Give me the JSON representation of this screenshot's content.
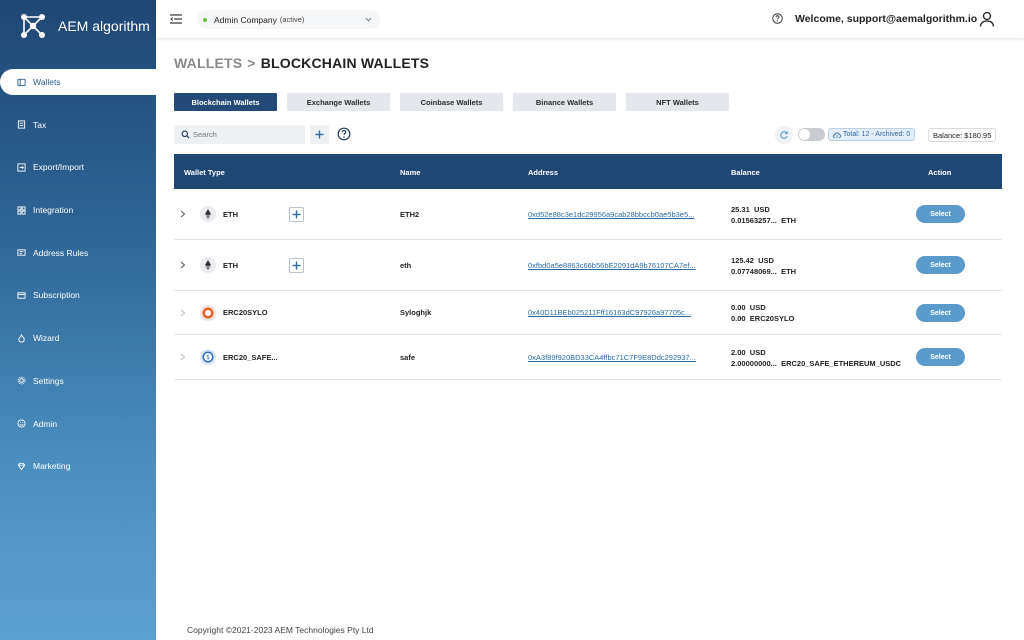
{
  "app": {
    "name": "AEM algorithm"
  },
  "sidebar": {
    "items": [
      {
        "label": "Wallets",
        "icon": "wallet-icon",
        "active": true
      },
      {
        "label": "Tax",
        "icon": "tax-icon"
      },
      {
        "label": "Export/Import",
        "icon": "export-import-icon"
      },
      {
        "label": "Integration",
        "icon": "integration-icon"
      },
      {
        "label": "Address Rules",
        "icon": "address-rules-icon"
      },
      {
        "label": "Subscription",
        "icon": "subscription-icon"
      },
      {
        "label": "Wizard",
        "icon": "wizard-icon"
      },
      {
        "label": "Settings",
        "icon": "gear-icon"
      },
      {
        "label": "Admin",
        "icon": "admin-icon"
      },
      {
        "label": "Marketing",
        "icon": "marketing-icon"
      }
    ]
  },
  "topbar": {
    "company": "Admin Company",
    "company_status": "(active)",
    "welcome": "Welcome, support@aemalgorithm.io"
  },
  "breadcrumb": {
    "parent": "WALLETS",
    "separator": ">",
    "current": "BLOCKCHAIN WALLETS"
  },
  "tabs": [
    {
      "label": "Blockchain Wallets",
      "active": true
    },
    {
      "label": "Exchange Wallets"
    },
    {
      "label": "Coinbase Wallets"
    },
    {
      "label": "Binance Wallets"
    },
    {
      "label": "NFT Wallets"
    }
  ],
  "toolbar": {
    "search_placeholder": "Search",
    "add_label": "+",
    "total_text": "Total: 12 - Archived: 0",
    "balance_text": "Balance: $180.95"
  },
  "table": {
    "headers": {
      "wallet_type": "Wallet Type",
      "name": "Name",
      "address": "Address",
      "balance": "Balance",
      "action": "Action"
    },
    "rows": [
      {
        "wallet_type": "ETH",
        "coin_icon": "ethereum-icon",
        "has_add": true,
        "name": "ETH2",
        "address": "0xd52e88c3e1dc29956a9cab28bbccb0ae5b3e5...",
        "usd_value": "25.31",
        "usd_unit": "USD",
        "token_value": "0.01563257...",
        "token_unit": "ETH",
        "action": "Select"
      },
      {
        "wallet_type": "ETH",
        "coin_icon": "ethereum-icon",
        "has_add": true,
        "name": "eth",
        "address": "0xfbd0a5e8863c66b56bE2091dA9b76107CA7ef...",
        "usd_value": "125.42",
        "usd_unit": "USD",
        "token_value": "0.07748069...",
        "token_unit": "ETH",
        "action": "Select"
      },
      {
        "wallet_type": "ERC20SYLO",
        "coin_icon": "sylo-icon",
        "has_add": false,
        "name": "Syloghjk",
        "address": "0x40D11BEb025211Fff16163dC97926a97705c...",
        "usd_value": "0.00",
        "usd_unit": "USD",
        "token_value": "0.00",
        "token_unit": "ERC20SYLO",
        "action": "Select"
      },
      {
        "wallet_type": "ERC20_SAFE...",
        "coin_icon": "safe-icon",
        "has_add": false,
        "name": "safe",
        "address": "0xA3f89f920BD33CA4ffbc71C7F9E8Ddc292937...",
        "usd_value": "2.00",
        "usd_unit": "USD",
        "token_value": "2.00000000...",
        "token_unit": "ERC20_SAFE_ETHEREUM_USDC",
        "action": "Select"
      }
    ]
  },
  "footer": {
    "copyright": "Copyright ©2021-2023 AEM Technologies Pty Ltd"
  },
  "colors": {
    "sidebar_top": "#1f4774",
    "sidebar_bottom": "#5aa2cf",
    "accent": "#234a76",
    "select_button": "#5b9bcb",
    "link": "#2b6aa3"
  }
}
